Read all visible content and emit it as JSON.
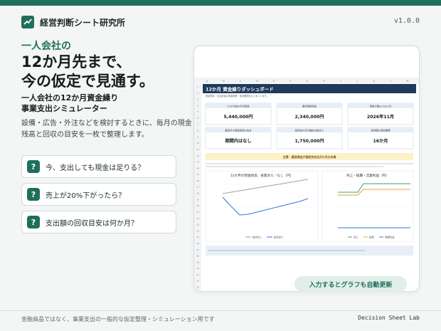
{
  "brand": {
    "name": "経営判断シート研究所",
    "version": "v1.0.0"
  },
  "hero": {
    "eyebrow": "一人会社の",
    "headline_line1": "12か月先まで、",
    "headline_line2": "今の仮定で見通す。",
    "subhead_line1": "一人会社の12か月資金繰り",
    "subhead_line2": "事業支出シミュレーター",
    "description": "設備・広告・外注などを検討するときに、毎月の現金残高と回収の目安を一枚で整理します。"
  },
  "questions": [
    {
      "mark": "?",
      "text": "今、支出しても現金は足りる？"
    },
    {
      "mark": "?",
      "text": "売上が20%下がったら？"
    },
    {
      "mark": "?",
      "text": "支出額の回収目安は何か月？"
    }
  ],
  "sheet": {
    "title": "12か月 資金繰りダッシュボード",
    "columns": [
      "A",
      "B",
      "C",
      "D",
      "E",
      "F",
      "G",
      "H",
      "I",
      "J",
      "K",
      "L",
      "M"
    ],
    "description_text": "現金残高・支出前後の現金推移・回収期間をまとめています。",
    "kpis": [
      {
        "label": "12か月後の平均残高",
        "value": "5,440,000円"
      },
      {
        "label": "最低現金残高",
        "value": "2,340,000円"
      },
      {
        "label": "現金が最も少ない月",
        "value": "2026年11月"
      },
      {
        "label": "最低月の現金残高の安全",
        "value": "期間内はなし"
      },
      {
        "label": "投資後の月次増加の推定上",
        "value": "1,750,000円"
      },
      {
        "label": "投資額の回収期間",
        "value": "16か月"
      }
    ],
    "notice": "注意：最低現金が固定的支出3か月分未満",
    "chart1": {
      "title": "12か月の現金残高：投資あり／なし（円）",
      "legend": [
        "投資なし",
        "投資あり"
      ]
    },
    "chart2": {
      "title": "売上・経費・営業利益（円）",
      "legend": [
        "売上",
        "経費",
        "営業利益"
      ]
    },
    "colors": {
      "header": "#1f3a5c",
      "accent": "#2e7ad6",
      "notice_bg": "#fdf1c9",
      "line_gray": "#9aa0a6",
      "orange": "#f0a32a",
      "green": "#37a66a"
    }
  },
  "auto_badge": "入力するとグラフも自動更新",
  "footer": {
    "note": "金融商品ではなく、事業支出の一般的な仮定整理・シミュレーション用です",
    "brand": "Decision Sheet Lab"
  }
}
